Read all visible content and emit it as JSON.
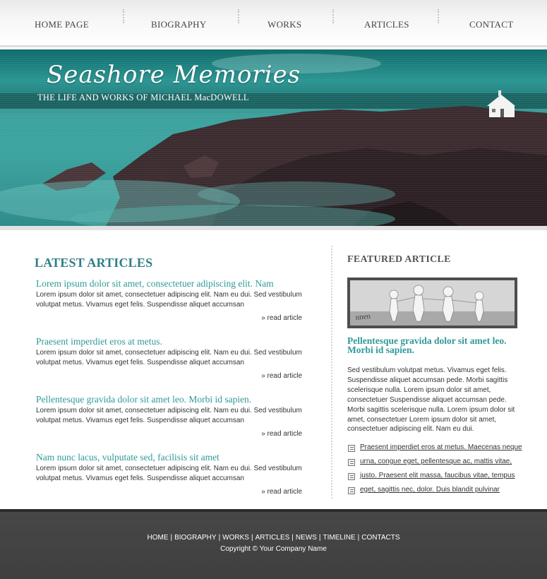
{
  "nav": {
    "items": [
      "HOME PAGE",
      "BIOGRAPHY",
      "WORKS",
      "ARTICLES",
      "CONTACT"
    ]
  },
  "banner": {
    "title": "Seashore Memories",
    "subtitle": "THE LIFE AND WORKS OF MICHAEL MacDOWELL"
  },
  "latest": {
    "heading": "LATEST ARTICLES",
    "read_more": "read article",
    "articles": [
      {
        "title": "Lorem ipsum dolor sit amet, consectetuer adipiscing elit. Nam",
        "excerpt": "Lorem ipsum dolor sit amet, consectetuer adipiscing elit. Nam eu dui. Sed vestibulum volutpat metus. Vivamus eget felis. Suspendisse aliquet accumsan"
      },
      {
        "title": "Praesent imperdiet eros at metus.",
        "excerpt": "Lorem ipsum dolor sit amet, consectetuer adipiscing elit. Nam eu dui. Sed vestibulum volutpat metus. Vivamus eget felis. Suspendisse aliquet accumsan"
      },
      {
        "title": "Pellentesque gravida dolor sit amet leo. Morbi id sapien.",
        "excerpt": "Lorem ipsum dolor sit amet, consectetuer adipiscing elit. Nam eu dui. Sed vestibulum volutpat metus. Vivamus eget felis. Suspendisse aliquet accumsan"
      },
      {
        "title": "Nam nunc lacus, vulputate sed, facilisis sit amet",
        "excerpt": "Lorem ipsum dolor sit amet, consectetuer adipiscing elit. Nam eu dui. Sed vestibulum volutpat metus. Vivamus eget felis. Suspendisse aliquet accumsan"
      }
    ]
  },
  "featured": {
    "heading": "FEATURED ARTICLE",
    "title": "Pellentesque gravida dolor sit amet leo. Morbi id sapien.",
    "body": "Sed vestibulum volutpat metus. Vivamus eget felis. Suspendisse aliquet accumsan pede. Morbi sagittis scelerisque nulla. Lorem ipsum dolor sit amet, consectetuer Suspendisse aliquet accumsan pede. Morbi sagittis scelerisque nulla. Lorem ipsum dolor sit amet, consectetuer Lorem ipsum dolor sit amet, consectetuer adipiscing elit. Nam eu dui.",
    "links": [
      "Praesent imperdiet eros at metus. Maecenas neque",
      "urna, congue eget, pellentesque ac, mattis vitae,",
      "justo. Praesent elit massa, faucibus vitae, tempus",
      "eget, sagittis nec, dolor. Duis blandit pulvinar"
    ],
    "image_icon": "paper-people-chain-image"
  },
  "footer": {
    "links": [
      "HOME",
      "BIOGRAPHY",
      "WORKS",
      "ARTICLES",
      "NEWS",
      "TIMELINE",
      "CONTACTS"
    ],
    "copyright": "Copyright © Your Company Name"
  },
  "colors": {
    "accent_teal": "#2f9a98",
    "heading_teal": "#2f7f86",
    "footer_bg": "#474747",
    "banner_teal": "#2b9a96"
  }
}
